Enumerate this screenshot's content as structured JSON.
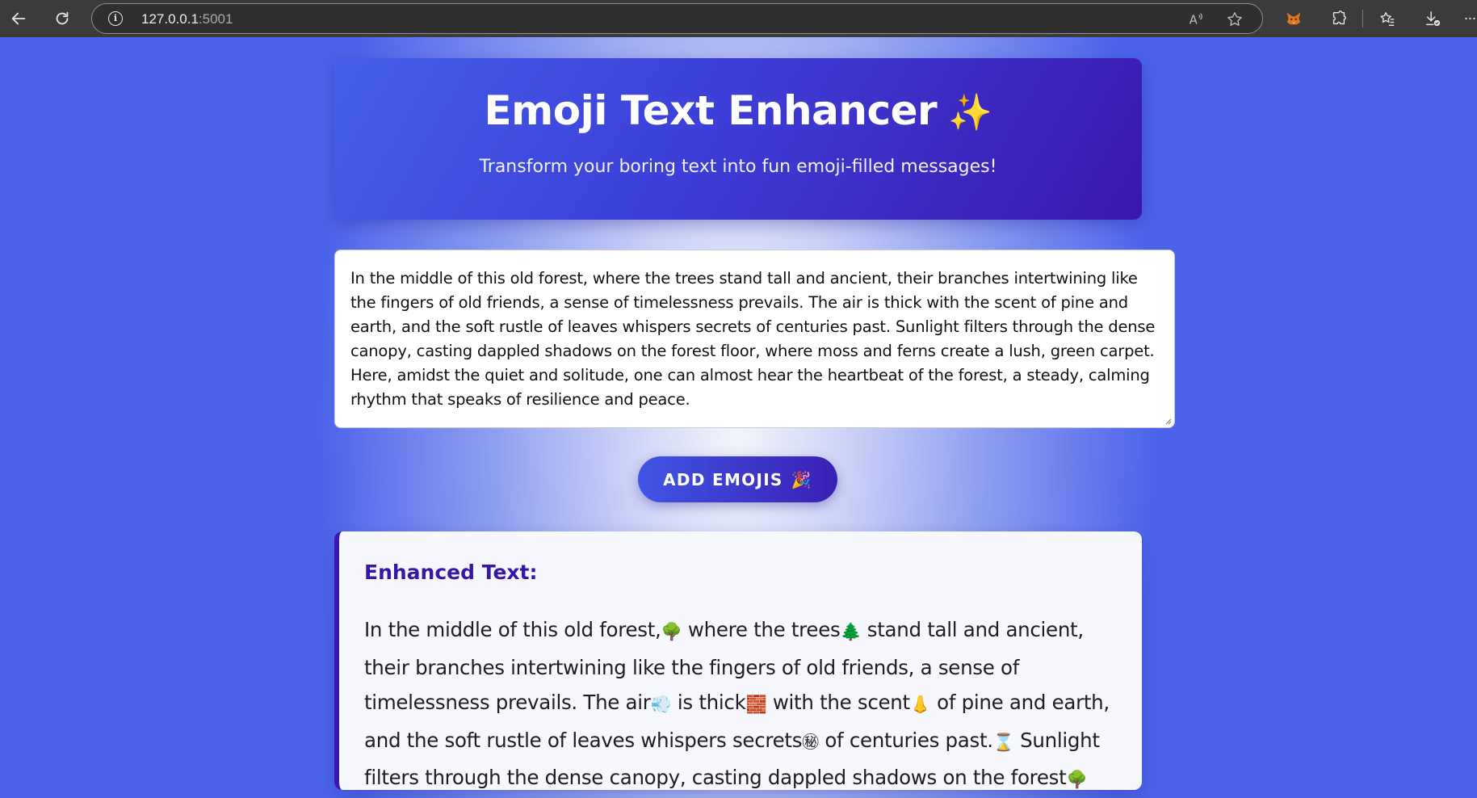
{
  "browser": {
    "url_host": "127.0.0.1",
    "url_port": ":5001"
  },
  "header": {
    "title": "Emoji Text Enhancer",
    "title_emoji": "✨",
    "subtitle": "Transform your boring text into fun emoji-filled messages!"
  },
  "input": {
    "value": "In the middle of this old forest, where the trees stand tall and ancient, their branches intertwining like the fingers of old friends, a sense of timelessness prevails. The air is thick with the scent of pine and earth, and the soft rustle of leaves whispers secrets of centuries past. Sunlight filters through the dense canopy, casting dappled shadows on the forest floor, where moss and ferns create a lush, green carpet. Here, amidst the quiet and solitude, one can almost hear the heartbeat of the forest, a steady, calming rhythm that speaks of resilience and peace."
  },
  "button": {
    "label": "ADD EMOJIS",
    "emoji": "🎉"
  },
  "result": {
    "heading": "Enhanced Text:",
    "segments": [
      "In the middle of this old forest,",
      "🌳",
      " where the trees",
      "🌲",
      " stand tall and ancient, their branches intertwining like the fingers of old friends, a sense of timelessness prevails. The air",
      "💨",
      " is thick",
      "🧱",
      " with the scent",
      "👃",
      " of pine and earth, and the soft rustle of leaves whispers secrets",
      "㊙",
      " of centuries past.",
      "⌛",
      " Sunlight filters through the dense canopy, casting dappled shadows on the forest",
      "🌳"
    ]
  },
  "colors": {
    "accent": "#3b17ad",
    "header_gradient_start": "#4460ea",
    "header_gradient_end": "#3b16ad",
    "page_edge": "#4b63ea"
  }
}
